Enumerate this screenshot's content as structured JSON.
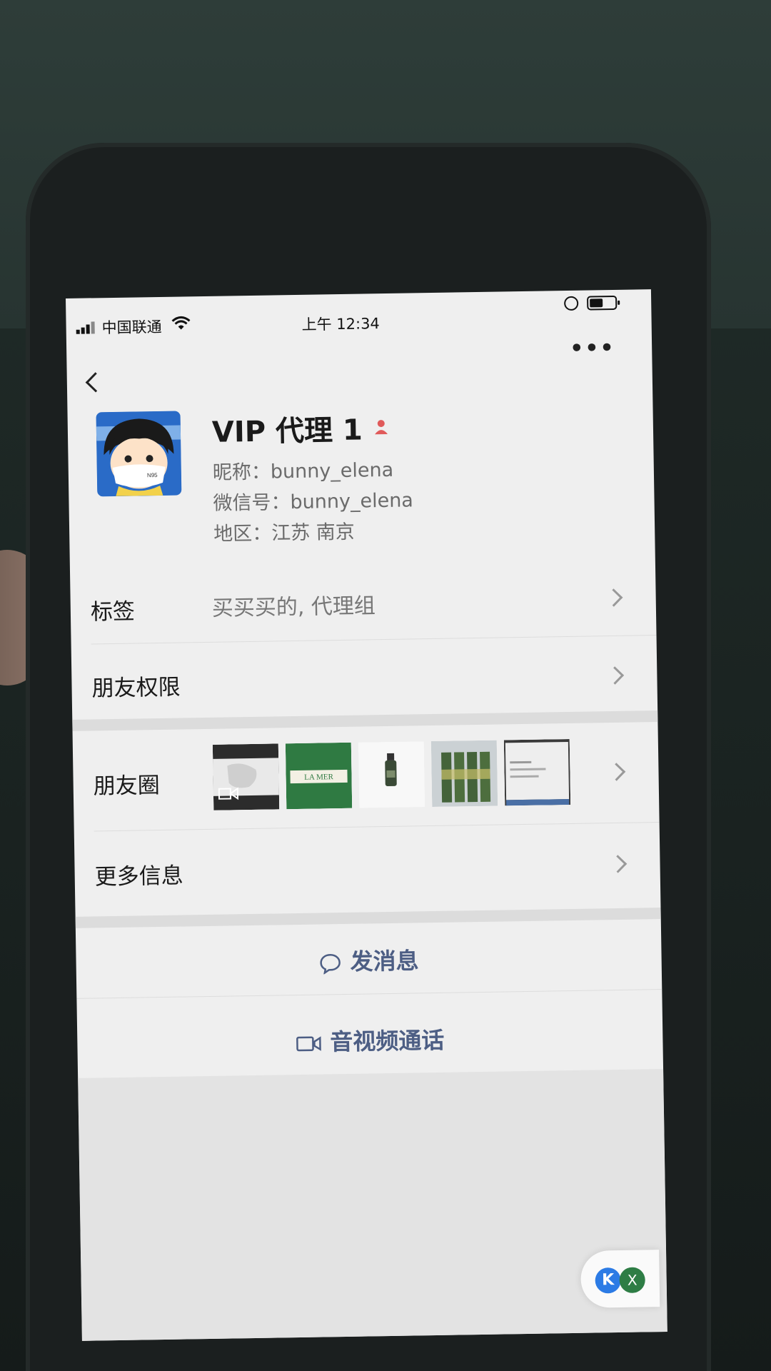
{
  "status_bar": {
    "carrier": "中国联通",
    "time": "上午 12:34"
  },
  "header": {
    "more_label": "•••"
  },
  "profile": {
    "name": "VIP 代理 1",
    "nickname_label": "昵称：",
    "nickname": "bunny_elena",
    "wechat_id_label": "微信号：",
    "wechat_id": "bunny_elena",
    "region_label": "地区：",
    "region": "江苏 南京",
    "avatar_badge": "N95"
  },
  "rows": {
    "tags_label": "标签",
    "tags_value": "买买买的, 代理组",
    "permissions_label": "朋友权限",
    "moments_label": "朋友圈",
    "more_info_label": "更多信息"
  },
  "moments_thumbs": {
    "t2_text": "LA MER"
  },
  "actions": {
    "message": "发消息",
    "video_call": "音视频通话"
  },
  "floating": {
    "k_label": "K",
    "x_label": "X"
  },
  "colors": {
    "action_text": "#4d5e84",
    "screen_bg": "#efefef",
    "gender_icon": "#e05a5a"
  }
}
